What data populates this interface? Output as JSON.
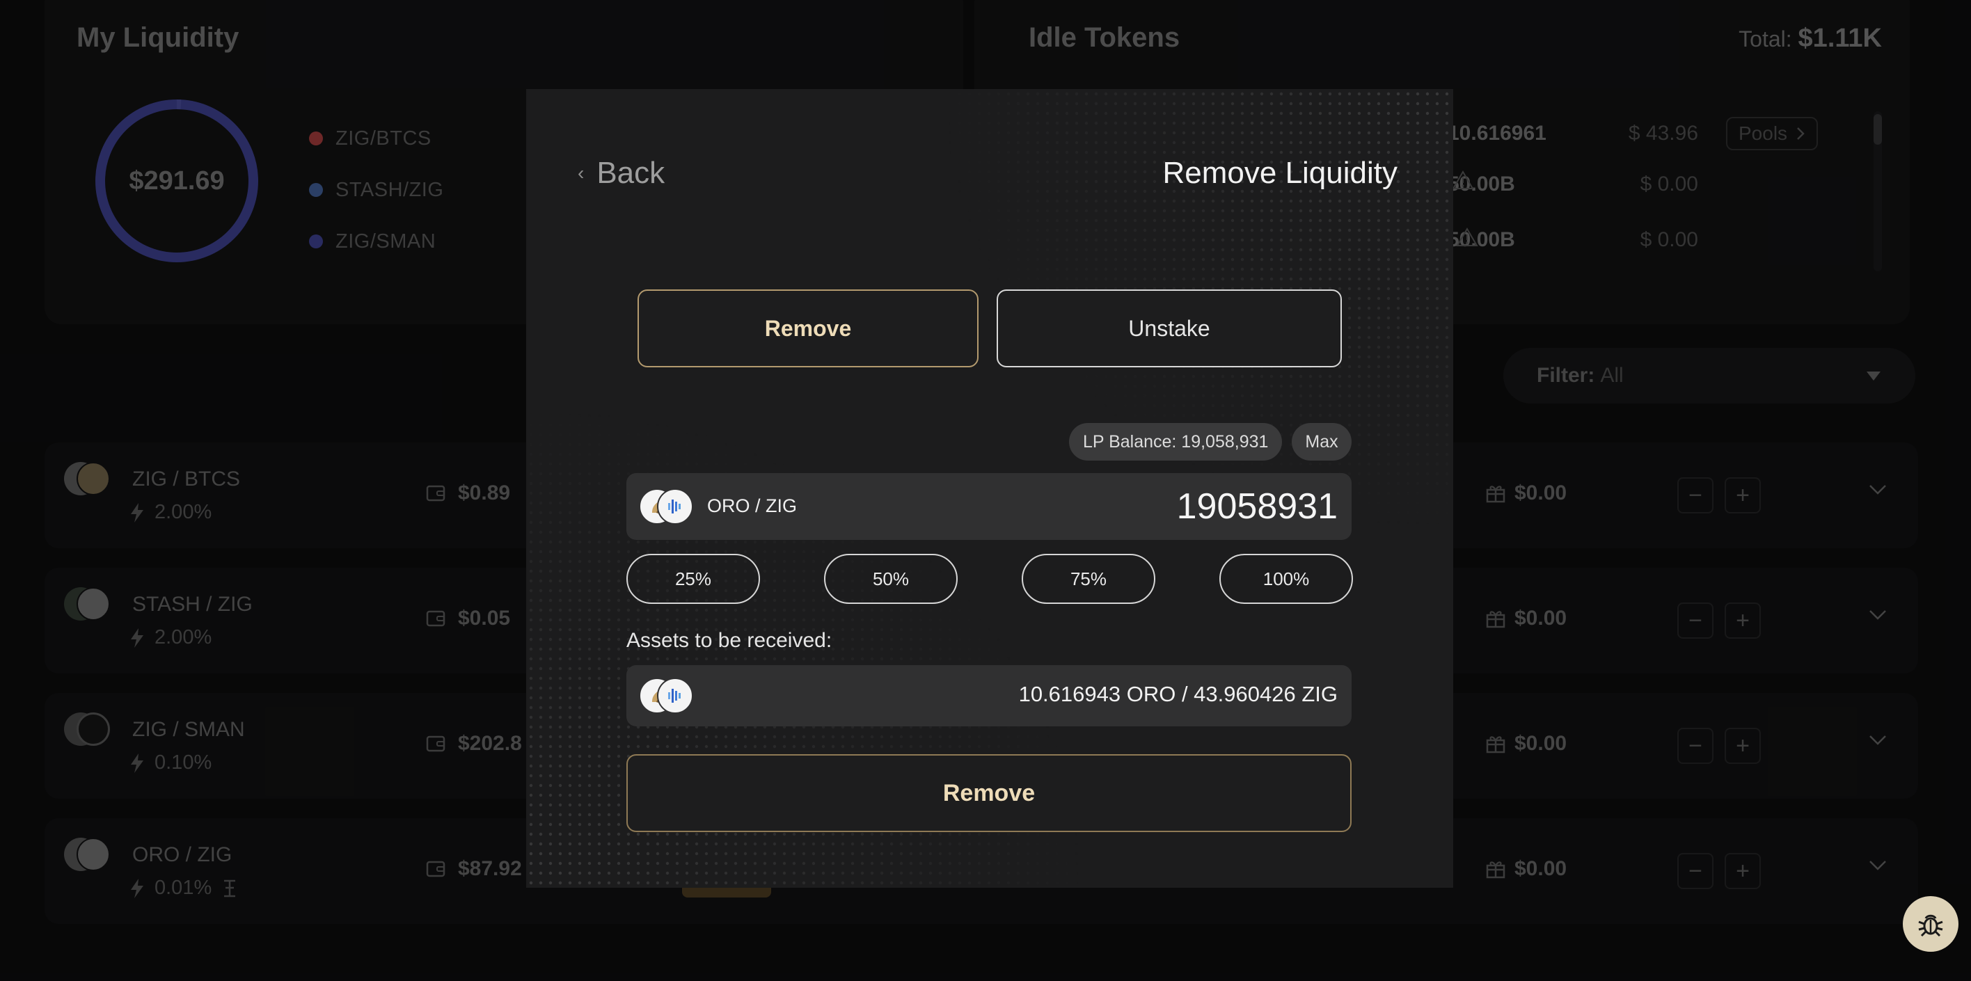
{
  "my_liquidity": {
    "title": "My Liquidity",
    "total_value": "$291.69",
    "legend": [
      {
        "label": "ZIG/BTCS",
        "color": "#c94a4a"
      },
      {
        "label": "STASH/ZIG",
        "color": "#4f74b8"
      },
      {
        "label": "ZIG/SMAN",
        "color": "#4b4fb0"
      }
    ]
  },
  "idle_tokens": {
    "title": "Idle Tokens",
    "total_label": "Total:",
    "total_value": "$1.11K",
    "rows": [
      {
        "amount": "10.616961",
        "usd": "$ 43.96",
        "action": "Pools"
      },
      {
        "amount": "50.00B",
        "usd": "$ 0.00"
      },
      {
        "amount": "50.00B",
        "usd": "$ 0.00"
      }
    ]
  },
  "filter": {
    "label": "Filter:",
    "value": "All"
  },
  "pools": [
    {
      "name": "ZIG / BTCS",
      "apr": "2.00%",
      "liquidity": "$0.89",
      "rewards": "$0.00"
    },
    {
      "name": "STASH / ZIG",
      "apr": "2.00%",
      "liquidity": "$0.05",
      "rewards": "$0.00"
    },
    {
      "name": "ZIG / SMAN",
      "apr": "0.10%",
      "liquidity": "$202.8",
      "rewards": "$0.00"
    },
    {
      "name": "ORO / ZIG",
      "apr": "0.01%",
      "liquidity": "$87.92",
      "rewards": "$0.00"
    }
  ],
  "modal": {
    "back_label": "Back",
    "title": "Remove Liquidity",
    "tabs": {
      "remove": "Remove",
      "unstake": "Unstake"
    },
    "lp_balance": "LP Balance: 19,058,931",
    "max_label": "Max",
    "pair_label": "ORO / ZIG",
    "amount_value": "19058931",
    "percent_buttons": [
      "25%",
      "50%",
      "75%",
      "100%"
    ],
    "assets_label": "Assets to be received:",
    "receive_text": "10.616943 ORO / 43.960426 ZIG",
    "submit_label": "Remove"
  },
  "colors": {
    "accent_gold": "#eedcb8",
    "donut": "#4b4fb0",
    "bug_button": "#ded3b8"
  }
}
